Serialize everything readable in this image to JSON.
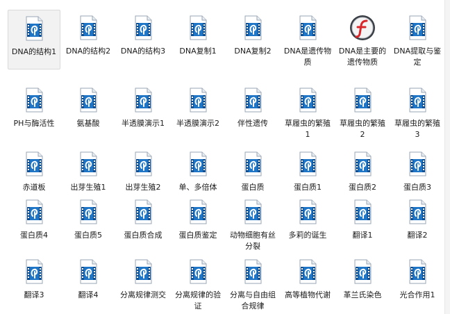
{
  "files": [
    {
      "label": "DNA的结构1",
      "icon": "media-file-icon",
      "selected": true
    },
    {
      "label": "DNA的结构2",
      "icon": "media-file-icon"
    },
    {
      "label": "DNA的结构3",
      "icon": "media-file-icon"
    },
    {
      "label": "DNA复制1",
      "icon": "media-file-icon"
    },
    {
      "label": "DNA复制2",
      "icon": "media-file-icon"
    },
    {
      "label": "DNA是遗传物质",
      "icon": "media-file-icon"
    },
    {
      "label": "DNA是主要的遗传物质",
      "icon": "flash-file-icon"
    },
    {
      "label": "DNA提取与鉴定",
      "icon": "media-file-icon"
    },
    {
      "label": "PH与酶活性",
      "icon": "media-file-icon"
    },
    {
      "label": "氨基酸",
      "icon": "media-file-icon"
    },
    {
      "label": "半透膜演示1",
      "icon": "media-file-icon"
    },
    {
      "label": "半透膜演示2",
      "icon": "media-file-icon"
    },
    {
      "label": "伴性遗传",
      "icon": "media-file-icon"
    },
    {
      "label": "草履虫的繁殖1",
      "icon": "media-file-icon"
    },
    {
      "label": "草履虫的繁殖2",
      "icon": "media-file-icon"
    },
    {
      "label": "草履虫的繁殖3",
      "icon": "media-file-icon"
    },
    {
      "label": "赤道板",
      "icon": "media-file-icon"
    },
    {
      "label": "出芽生殖1",
      "icon": "media-file-icon"
    },
    {
      "label": "出芽生殖2",
      "icon": "media-file-icon"
    },
    {
      "label": "单、多倍体",
      "icon": "media-file-icon"
    },
    {
      "label": "蛋白质",
      "icon": "media-file-icon"
    },
    {
      "label": "蛋白质1",
      "icon": "media-file-icon"
    },
    {
      "label": "蛋白质2",
      "icon": "media-file-icon"
    },
    {
      "label": "蛋白质3",
      "icon": "media-file-icon"
    },
    {
      "label": "蛋白质4",
      "icon": "media-file-icon"
    },
    {
      "label": "蛋白质5",
      "icon": "media-file-icon"
    },
    {
      "label": "蛋白质合成",
      "icon": "media-file-icon"
    },
    {
      "label": "蛋白质鉴定",
      "icon": "media-file-icon"
    },
    {
      "label": "动物细胞有丝分裂",
      "icon": "media-file-icon"
    },
    {
      "label": "多莉的诞生",
      "icon": "media-file-icon"
    },
    {
      "label": "翻译1",
      "icon": "media-file-icon"
    },
    {
      "label": "翻译2",
      "icon": "media-file-icon"
    },
    {
      "label": "翻译3",
      "icon": "media-file-icon"
    },
    {
      "label": "翻译4",
      "icon": "media-file-icon"
    },
    {
      "label": "分离规律测交",
      "icon": "media-file-icon"
    },
    {
      "label": "分离规律的验证",
      "icon": "media-file-icon"
    },
    {
      "label": "分离与自由组合规律",
      "icon": "media-file-icon"
    },
    {
      "label": "高等植物代谢",
      "icon": "media-file-icon"
    },
    {
      "label": "革兰氏染色",
      "icon": "media-file-icon"
    },
    {
      "label": "光合作用1",
      "icon": "media-file-icon"
    }
  ],
  "colors": {
    "icon_blue": "#1f76c7",
    "icon_blue_dark": "#0e4f93",
    "page_white": "#ffffff",
    "flash_red": "#d8262b"
  }
}
